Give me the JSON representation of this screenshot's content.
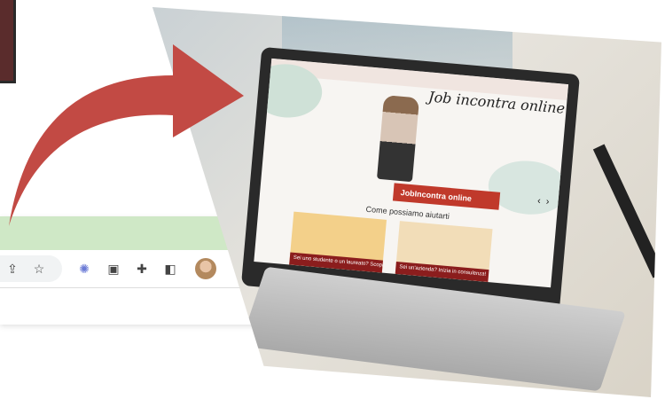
{
  "browser": {
    "tab_chevron": "⌄",
    "toolbar_icons": [
      "share-icon",
      "star-icon",
      "spark-icon",
      "screen-icon",
      "puzzle-icon",
      "sidepanel-icon",
      "avatar",
      "more-icon"
    ]
  },
  "laptop_screen": {
    "brand": "Job incontra online",
    "cta_label": "JobIncontra online",
    "section_title": "Come possiamo aiutarti",
    "card1_label": "Sei uno studente o un laureato? Scopri i",
    "card2_label": "Sei un'azienda? Inizia in consulenza!",
    "nav_prev": "‹",
    "nav_next": "›"
  },
  "colors": {
    "arrow": "#c24a44",
    "tabbar": "#cfe8c6",
    "cta": "#c0392b",
    "card_label_bg": "#8b1d1d"
  }
}
